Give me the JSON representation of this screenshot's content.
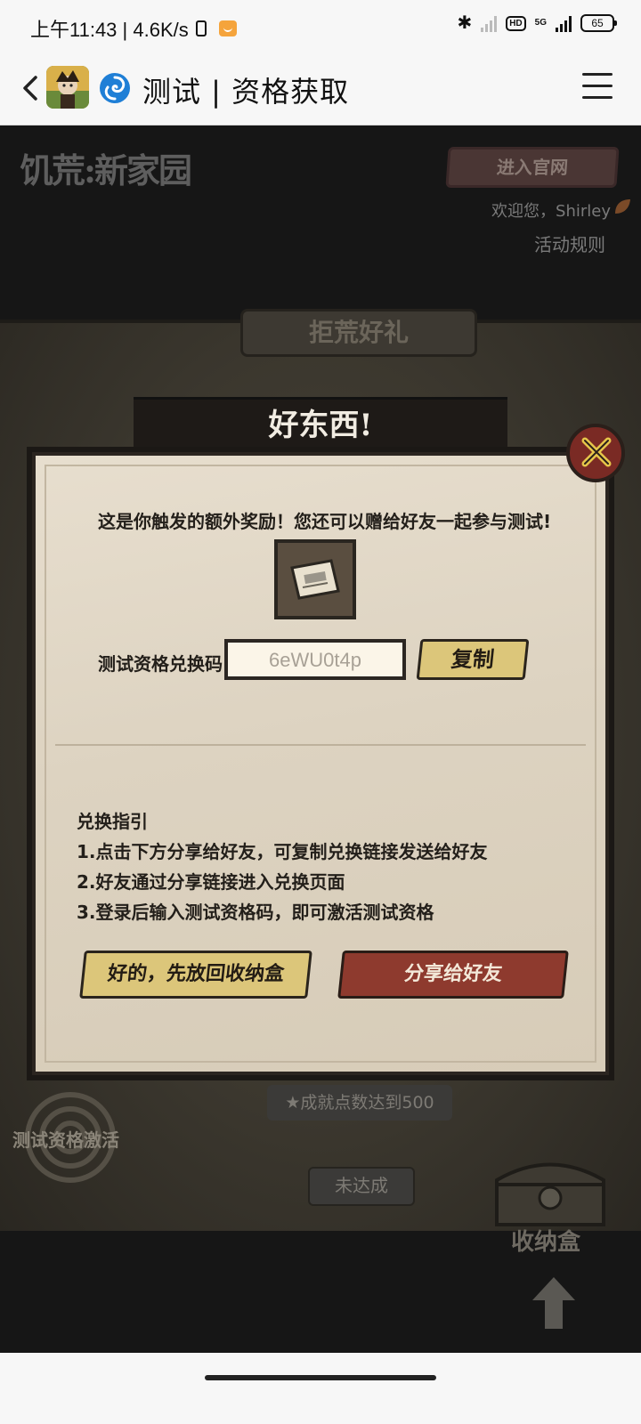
{
  "status_bar": {
    "time_speed": "上午11:43 | 4.6K/s",
    "battery": "65",
    "network": "5G",
    "hd": "HD"
  },
  "nav": {
    "title": "测试 | 资格获取"
  },
  "game": {
    "logo": "饥荒:新家园",
    "official_button": "进入官网",
    "welcome": "欢迎您，Shirley",
    "rules_link": "活动规则",
    "board_title": "拒荒好礼",
    "achievement_badge": "★成就点数达到500",
    "not_done_button": "未达成",
    "activate_label": "测试资格激活",
    "chest_label": "收纳盒"
  },
  "modal": {
    "title": "好东西!",
    "description": "这是你触发的额外奖励！您还可以赠给好友一起参与测试!",
    "code_label": "测试资格兑换码",
    "code_value": "6eWU0t4p",
    "copy_button": "复制",
    "guide": {
      "heading": "兑换指引",
      "steps": [
        "1.点击下方分享给好友，可复制兑换链接发送给好友",
        "2.好友通过分享链接进入兑换页面",
        "3.登录后输入测试资格码，即可激活测试资格"
      ]
    },
    "ok_button": "好的，先放回收纳盒",
    "share_button": "分享给好友"
  },
  "colors": {
    "accent_gold": "#dcc67a",
    "accent_red": "#8e3a2e",
    "parchment": "#e7dece"
  }
}
